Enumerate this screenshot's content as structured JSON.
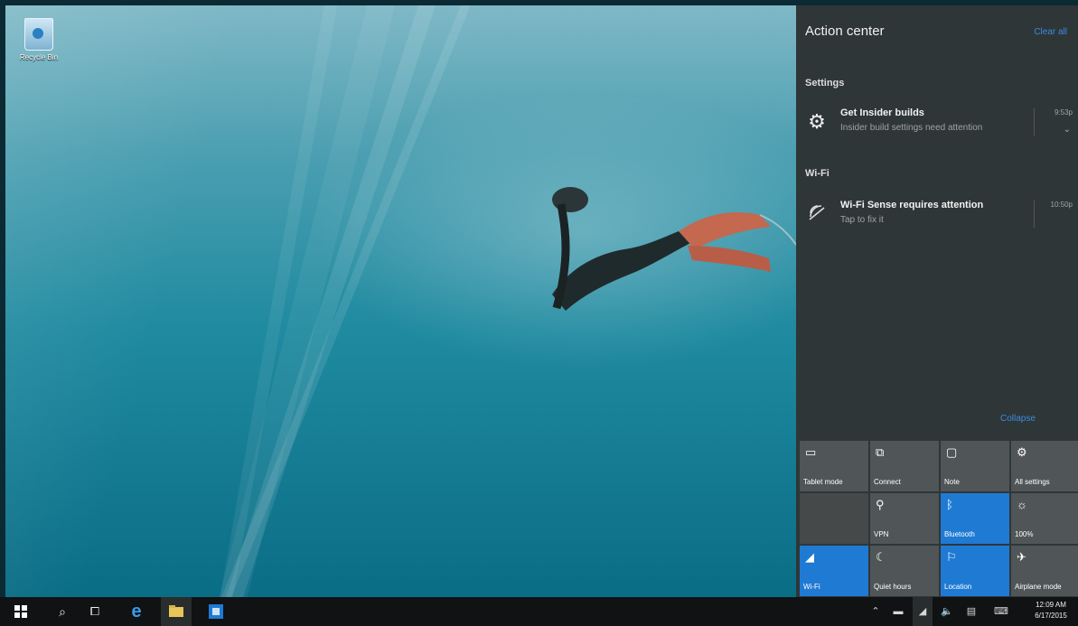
{
  "desktop": {
    "recycle_label": "Recycle Bin"
  },
  "action_center": {
    "title": "Action center",
    "clear_all": "Clear all",
    "groups": [
      {
        "name": "Settings",
        "notifications": [
          {
            "icon": "gear-icon",
            "title": "Get Insider builds",
            "body": "Insider build settings need attention",
            "time": "9:53p"
          }
        ]
      },
      {
        "name": "Wi-Fi",
        "notifications": [
          {
            "icon": "wifi-icon",
            "title": "Wi-Fi Sense requires attention",
            "body": "Tap to fix it",
            "time": "10:50p"
          }
        ]
      }
    ],
    "collapse": "Collapse",
    "quick_actions": [
      {
        "label": "Tablet mode",
        "icon": "tablet-icon",
        "state": "off"
      },
      {
        "label": "Connect",
        "icon": "connect-icon",
        "state": "off"
      },
      {
        "label": "Note",
        "icon": "note-icon",
        "state": "off"
      },
      {
        "label": "All settings",
        "icon": "settings-icon",
        "state": "off"
      },
      {
        "label": "",
        "icon": "",
        "state": "disabled"
      },
      {
        "label": "VPN",
        "icon": "vpn-icon",
        "state": "off"
      },
      {
        "label": "Bluetooth",
        "icon": "bluetooth-icon",
        "state": "on"
      },
      {
        "label": "100%",
        "icon": "brightness-icon",
        "state": "off"
      },
      {
        "label": "Wi-Fi",
        "icon": "wifi-icon",
        "state": "on"
      },
      {
        "label": "Quiet hours",
        "icon": "moon-icon",
        "state": "off"
      },
      {
        "label": "Location",
        "icon": "location-icon",
        "state": "on"
      },
      {
        "label": "Airplane mode",
        "icon": "airplane-icon",
        "state": "off"
      }
    ]
  },
  "taskbar": {
    "clock_time": "12:09 AM",
    "clock_date": "6/17/2015"
  },
  "colors": {
    "accent": "#1f7ad4",
    "panel": "#2f3637",
    "link": "#3b8be0",
    "taskbar": "#101213"
  }
}
